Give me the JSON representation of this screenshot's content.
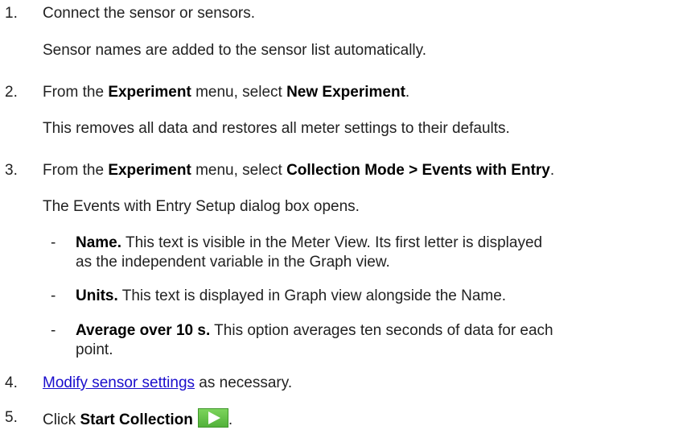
{
  "steps": [
    {
      "number": "1.",
      "text": "Connect the sensor or sensors.",
      "note": "Sensor names are added to the sensor list automatically."
    },
    {
      "number": "2.",
      "pre": "From the ",
      "menu": "Experiment",
      "mid": " menu, select ",
      "command": "New Experiment",
      "post": ".",
      "note": "This removes all data and restores all meter settings to their defaults."
    },
    {
      "number": "3.",
      "pre": "From the ",
      "menu": "Experiment",
      "mid": " menu, select ",
      "command": "Collection Mode > Events with Entry",
      "post": ".",
      "note": "The Events with Entry Setup dialog box opens.",
      "bullets": [
        {
          "dash": "-",
          "label": "Name.",
          "line1": " This text is visible in the Meter View. Its first letter is displayed",
          "line2": "as the independent variable in the Graph view."
        },
        {
          "dash": "-",
          "label": "Units.",
          "line1": " This text is displayed in Graph view alongside the Name."
        },
        {
          "dash": "-",
          "label": "Average over 10 s.",
          "line1": " This option averages ten seconds of data for each",
          "line2": "point."
        }
      ]
    },
    {
      "number": "4.",
      "link": "Modify sensor settings",
      "post": " as necessary."
    },
    {
      "number": "5.",
      "pre": "Click ",
      "command": "Start Collection",
      "post": "."
    }
  ],
  "colors": {
    "link": "#1a0dcc",
    "start_button": "#5cc040",
    "start_icon": "#ffffff"
  },
  "icons": {
    "start_collection": "play-triangle-icon"
  }
}
